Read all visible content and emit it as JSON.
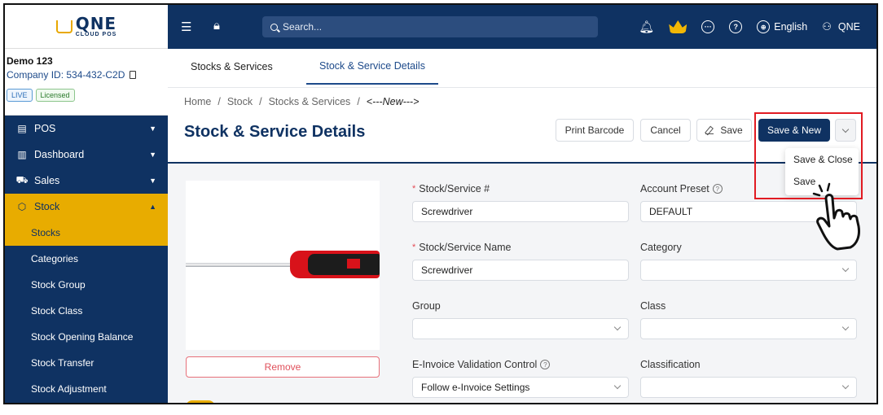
{
  "brand": {
    "logo_main": "QNE",
    "logo_sub": "CLOUD POS"
  },
  "company": {
    "name": "Demo 123",
    "id_text": "Company ID: 534-432-C2D",
    "badge_live": "LIVE",
    "badge_licensed": "Licensed"
  },
  "sidebar": {
    "items": [
      {
        "label": "POS",
        "icon": "pos-icon"
      },
      {
        "label": "Dashboard",
        "icon": "dashboard-icon"
      },
      {
        "label": "Sales",
        "icon": "sales-icon"
      },
      {
        "label": "Stock",
        "icon": "stock-icon"
      }
    ],
    "stock_sub": [
      "Stocks",
      "Categories",
      "Stock Group",
      "Stock Class",
      "Stock Opening Balance",
      "Stock Transfer",
      "Stock Adjustment"
    ]
  },
  "topbar": {
    "search_placeholder": "Search...",
    "language": "English",
    "user": "QNE"
  },
  "tabs": [
    "Stocks & Services",
    "Stock & Service Details"
  ],
  "breadcrumb": [
    "Home",
    "Stock",
    "Stocks & Services",
    "<---New--->"
  ],
  "page_title": "Stock & Service Details",
  "actions": {
    "print_barcode": "Print Barcode",
    "cancel": "Cancel",
    "save": "Save",
    "save_new": "Save & New"
  },
  "dropdown_menu": [
    "Save & Close",
    "Save"
  ],
  "image": {
    "remove": "Remove"
  },
  "form": {
    "stock_no_label": "Stock/Service #",
    "stock_no_value": "Screwdriver",
    "account_preset_label": "Account Preset",
    "account_preset_value": "DEFAULT",
    "stock_name_label": "Stock/Service Name",
    "stock_name_value": "Screwdriver",
    "category_label": "Category",
    "category_value": "",
    "group_label": "Group",
    "group_value": "",
    "class_label": "Class",
    "class_value": "",
    "einvoice_label": "E-Invoice Validation Control",
    "einvoice_value": "Follow e-Invoice Settings",
    "classification_label": "Classification",
    "classification_value": ""
  },
  "colors": {
    "navy": "#0f3262",
    "accent_yellow": "#e8ac00",
    "highlight_red": "#e11b22",
    "danger": "#e0505b"
  }
}
